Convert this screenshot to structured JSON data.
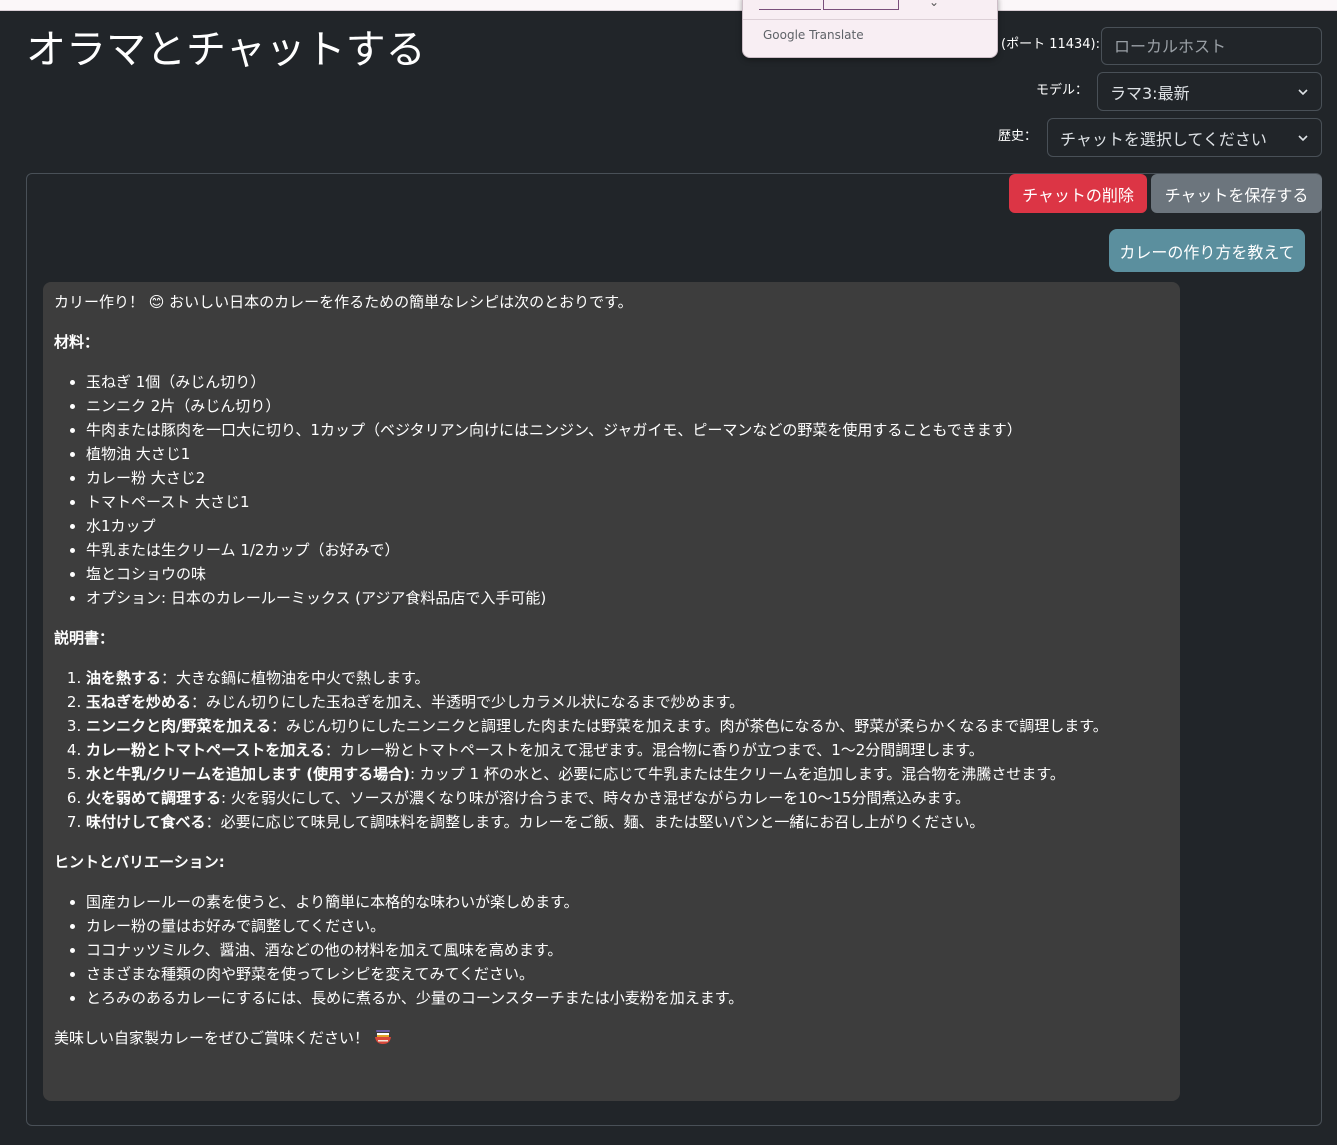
{
  "page": {
    "title": "オラマとチャットする"
  },
  "controls": {
    "port_label": "(ポート 11434):",
    "host_placeholder": "ローカルホスト",
    "model_label": "モデル：",
    "model_value": "ラマ3:最新",
    "history_label": "歴史：",
    "history_value": "チャットを選択してください"
  },
  "translate_popup": {
    "brand": "Google Translate"
  },
  "chat": {
    "delete_label": "チャットの削除",
    "save_label": "チャットを保存する",
    "user_message": "カレーの作り方を教えて",
    "response": {
      "intro": "カリー作り！ 😊 おいしい日本のカレーを作るための簡単なレシピは次のとおりです。",
      "ingredients_heading": "材料：",
      "ingredients": [
        "玉ねぎ 1個（みじん切り）",
        "ニンニク 2片（みじん切り）",
        "牛肉または豚肉を一口大に切り、1カップ（ベジタリアン向けにはニンジン、ジャガイモ、ピーマンなどの野菜を使用することもできます）",
        "植物油 大さじ1",
        "カレー粉 大さじ2",
        "トマトペースト 大さじ1",
        "水1カップ",
        "牛乳または生クリーム 1/2カップ（お好みで）",
        "塩とコショウの味",
        "オプション: 日本のカレールーミックス (アジア食料品店で入手可能)"
      ],
      "instructions_heading": "説明書：",
      "steps": [
        {
          "title": "油を熱する",
          "text": "：大きな鍋に植物油を中火で熱します。"
        },
        {
          "title": "玉ねぎを炒める",
          "text": "：みじん切りにした玉ねぎを加え、半透明で少しカラメル状になるまで炒めます。"
        },
        {
          "title": "ニンニクと肉/野菜を加える",
          "text": "：みじん切りにしたニンニクと調理した肉または野菜を加えます。肉が茶色になるか、野菜が柔らかくなるまで調理します。"
        },
        {
          "title": "カレー粉とトマトペーストを加える",
          "text": "：カレー粉とトマトペーストを加えて混ぜます。混合物に香りが立つまで、1～2分間調理します。"
        },
        {
          "title": "水と牛乳/クリームを追加します (使用する場合)",
          "text": ": カップ 1 杯の水と、必要に応じて牛乳または生クリームを追加します。混合物を沸騰させます。"
        },
        {
          "title": "火を弱めて調理する",
          "text": ": 火を弱火にして、ソースが濃くなり味が溶け合うまで、時々かき混ぜながらカレーを10～15分間煮込みます。"
        },
        {
          "title": "味付けして食べる",
          "text": "：必要に応じて味見して調味料を調整します。カレーをご飯、麺、または堅いパンと一緒にお召し上がりください。"
        }
      ],
      "tips_heading": "ヒントとバリエーション:",
      "tips": [
        "国産カレールーの素を使うと、より簡単に本格的な味わいが楽しめます。",
        "カレー粉の量はお好みで調整してください。",
        "ココナッツミルク、醤油、酒などの他の材料を加えて風味を高めます。",
        "さまざまな種類の肉や野菜を使ってレシピを変えてみてください。",
        "とろみのあるカレーにするには、長めに煮るか、少量のコーンスターチまたは小麦粉を加えます。"
      ],
      "closing": "美味しい自家製カレーをぜひご賞味ください！",
      "closing_icon": "curry-bowl-icon"
    }
  },
  "colors": {
    "background": "#212529",
    "delete_button": "#dc3545",
    "save_button": "#6c757d",
    "user_bubble": "#5b8f9e",
    "bot_bubble": "#3d3d3d"
  }
}
